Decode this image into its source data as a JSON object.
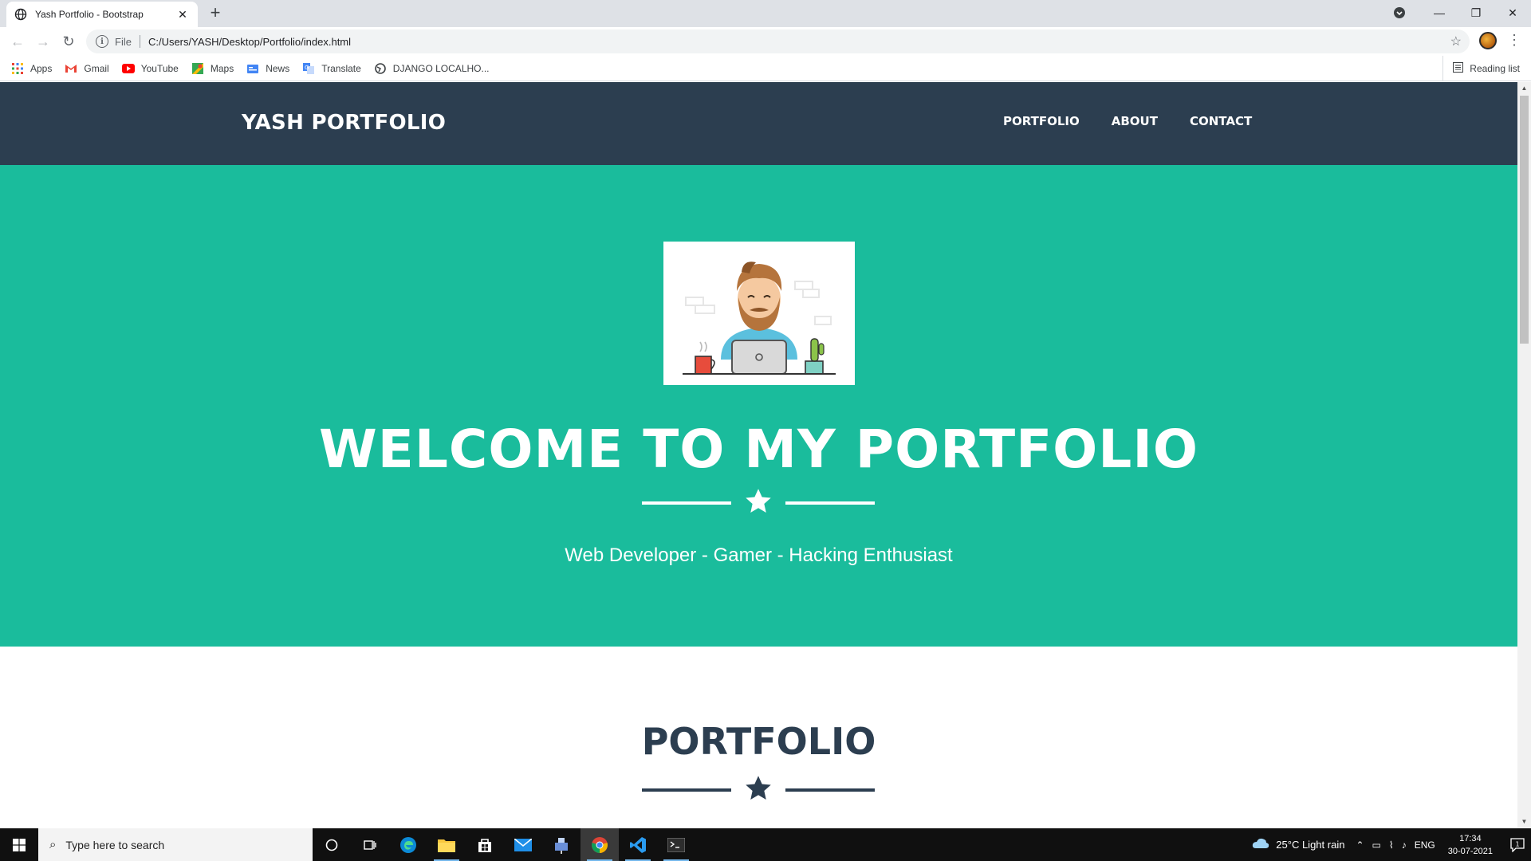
{
  "browser": {
    "tab_title": "Yash Portfolio - Bootstrap",
    "tab_close": "✕",
    "new_tab": "+",
    "scheme": "File",
    "url": "C:/Users/YASH/Desktop/Portfolio/index.html",
    "bookmarks": [
      {
        "label": "Apps",
        "icon": "apps-grid-icon"
      },
      {
        "label": "Gmail",
        "icon": "gmail-icon"
      },
      {
        "label": "YouTube",
        "icon": "youtube-icon"
      },
      {
        "label": "Maps",
        "icon": "maps-icon"
      },
      {
        "label": "News",
        "icon": "news-icon"
      },
      {
        "label": "Translate",
        "icon": "translate-icon"
      },
      {
        "label": "DJANGO LOCALHO...",
        "icon": "globe-icon"
      }
    ],
    "reading_list": "Reading list"
  },
  "site": {
    "brand": "YASH PORTFOLIO",
    "nav": [
      "PORTFOLIO",
      "ABOUT",
      "CONTACT"
    ],
    "hero_title": "WELCOME TO MY PORTFOLIO",
    "hero_subtitle": "Web Developer - Gamer - Hacking Enthusiast",
    "section_title": "PORTFOLIO",
    "colors": {
      "navbar": "#2c3e50",
      "hero": "#1abc9c",
      "text_dark": "#2c3e50"
    }
  },
  "taskbar": {
    "search_placeholder": "Type here to search",
    "weather": "25°C  Light rain",
    "lang": "ENG",
    "time": "17:34",
    "date": "30-07-2021",
    "notification_count": "1"
  }
}
